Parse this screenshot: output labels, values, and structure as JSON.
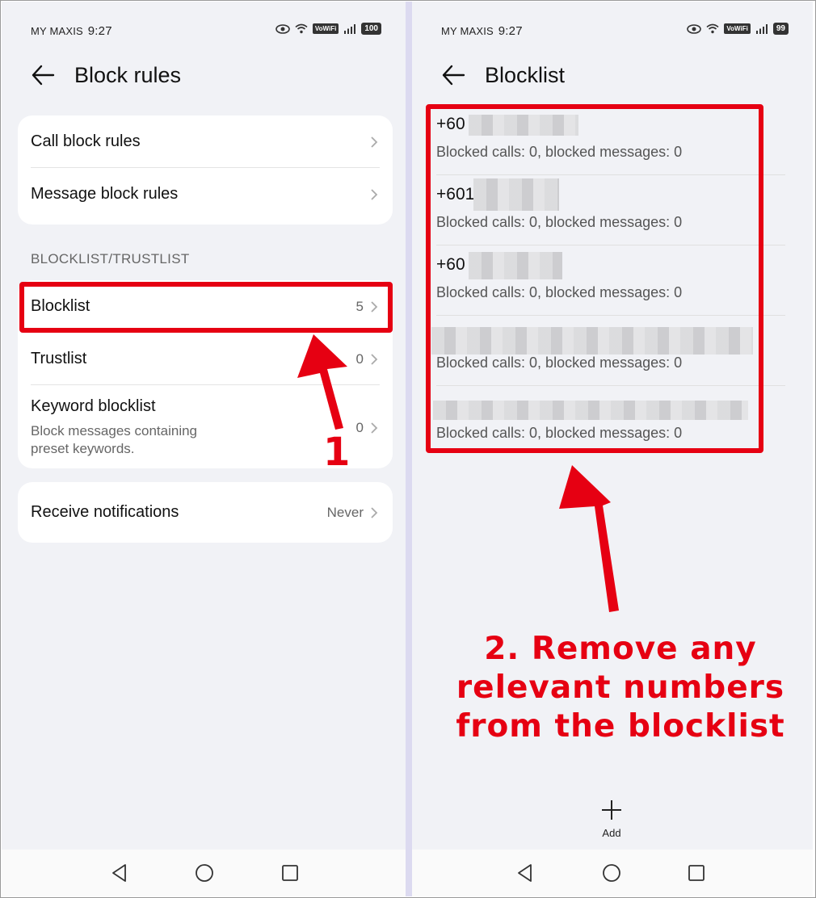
{
  "left_screen": {
    "status": {
      "carrier": "MY MAXIS",
      "time": "9:27",
      "vowifi": "VoWiFi",
      "battery": "100"
    },
    "title": "Block rules",
    "rules_card": [
      {
        "label": "Call block rules"
      },
      {
        "label": "Message block rules"
      }
    ],
    "section_header": "BLOCKLIST/TRUSTLIST",
    "lists_card": {
      "blocklist": {
        "label": "Blocklist",
        "count": "5"
      },
      "trustlist": {
        "label": "Trustlist",
        "count": "0"
      },
      "keyword": {
        "label": "Keyword blocklist",
        "sub_line1": "Block messages containing",
        "sub_line2": "preset keywords.",
        "count": "0"
      }
    },
    "notifications": {
      "label": "Receive notifications",
      "value": "Never"
    },
    "annotation": "1"
  },
  "right_screen": {
    "status": {
      "carrier": "MY MAXIS",
      "time": "9:27",
      "vowifi": "VoWiFi",
      "battery": "99"
    },
    "title": "Blocklist",
    "entries": [
      {
        "number_prefix": "+60",
        "stats": "Blocked calls: 0, blocked messages: 0"
      },
      {
        "number_prefix": "+601",
        "stats": "Blocked calls: 0, blocked messages: 0"
      },
      {
        "number_prefix": "+60",
        "stats": "Blocked calls: 0, blocked messages: 0"
      },
      {
        "number_prefix": "",
        "stats": "Blocked calls: 0, blocked messages: 0"
      },
      {
        "number_prefix": "",
        "stats": "Blocked calls: 0, blocked messages: 0"
      }
    ],
    "add_label": "Add",
    "annotation_lines": [
      "2. Remove any",
      "relevant numbers",
      "from the blocklist"
    ]
  },
  "colors": {
    "annotation_red": "#e60012",
    "background": "#f1f2f6",
    "card": "#ffffff"
  },
  "icons": [
    "back-arrow-icon",
    "chevron-right-icon",
    "eye-icon",
    "wifi-icon",
    "signal-icon",
    "battery-icon",
    "plus-icon",
    "nav-back-icon",
    "nav-home-icon",
    "nav-recents-icon"
  ]
}
